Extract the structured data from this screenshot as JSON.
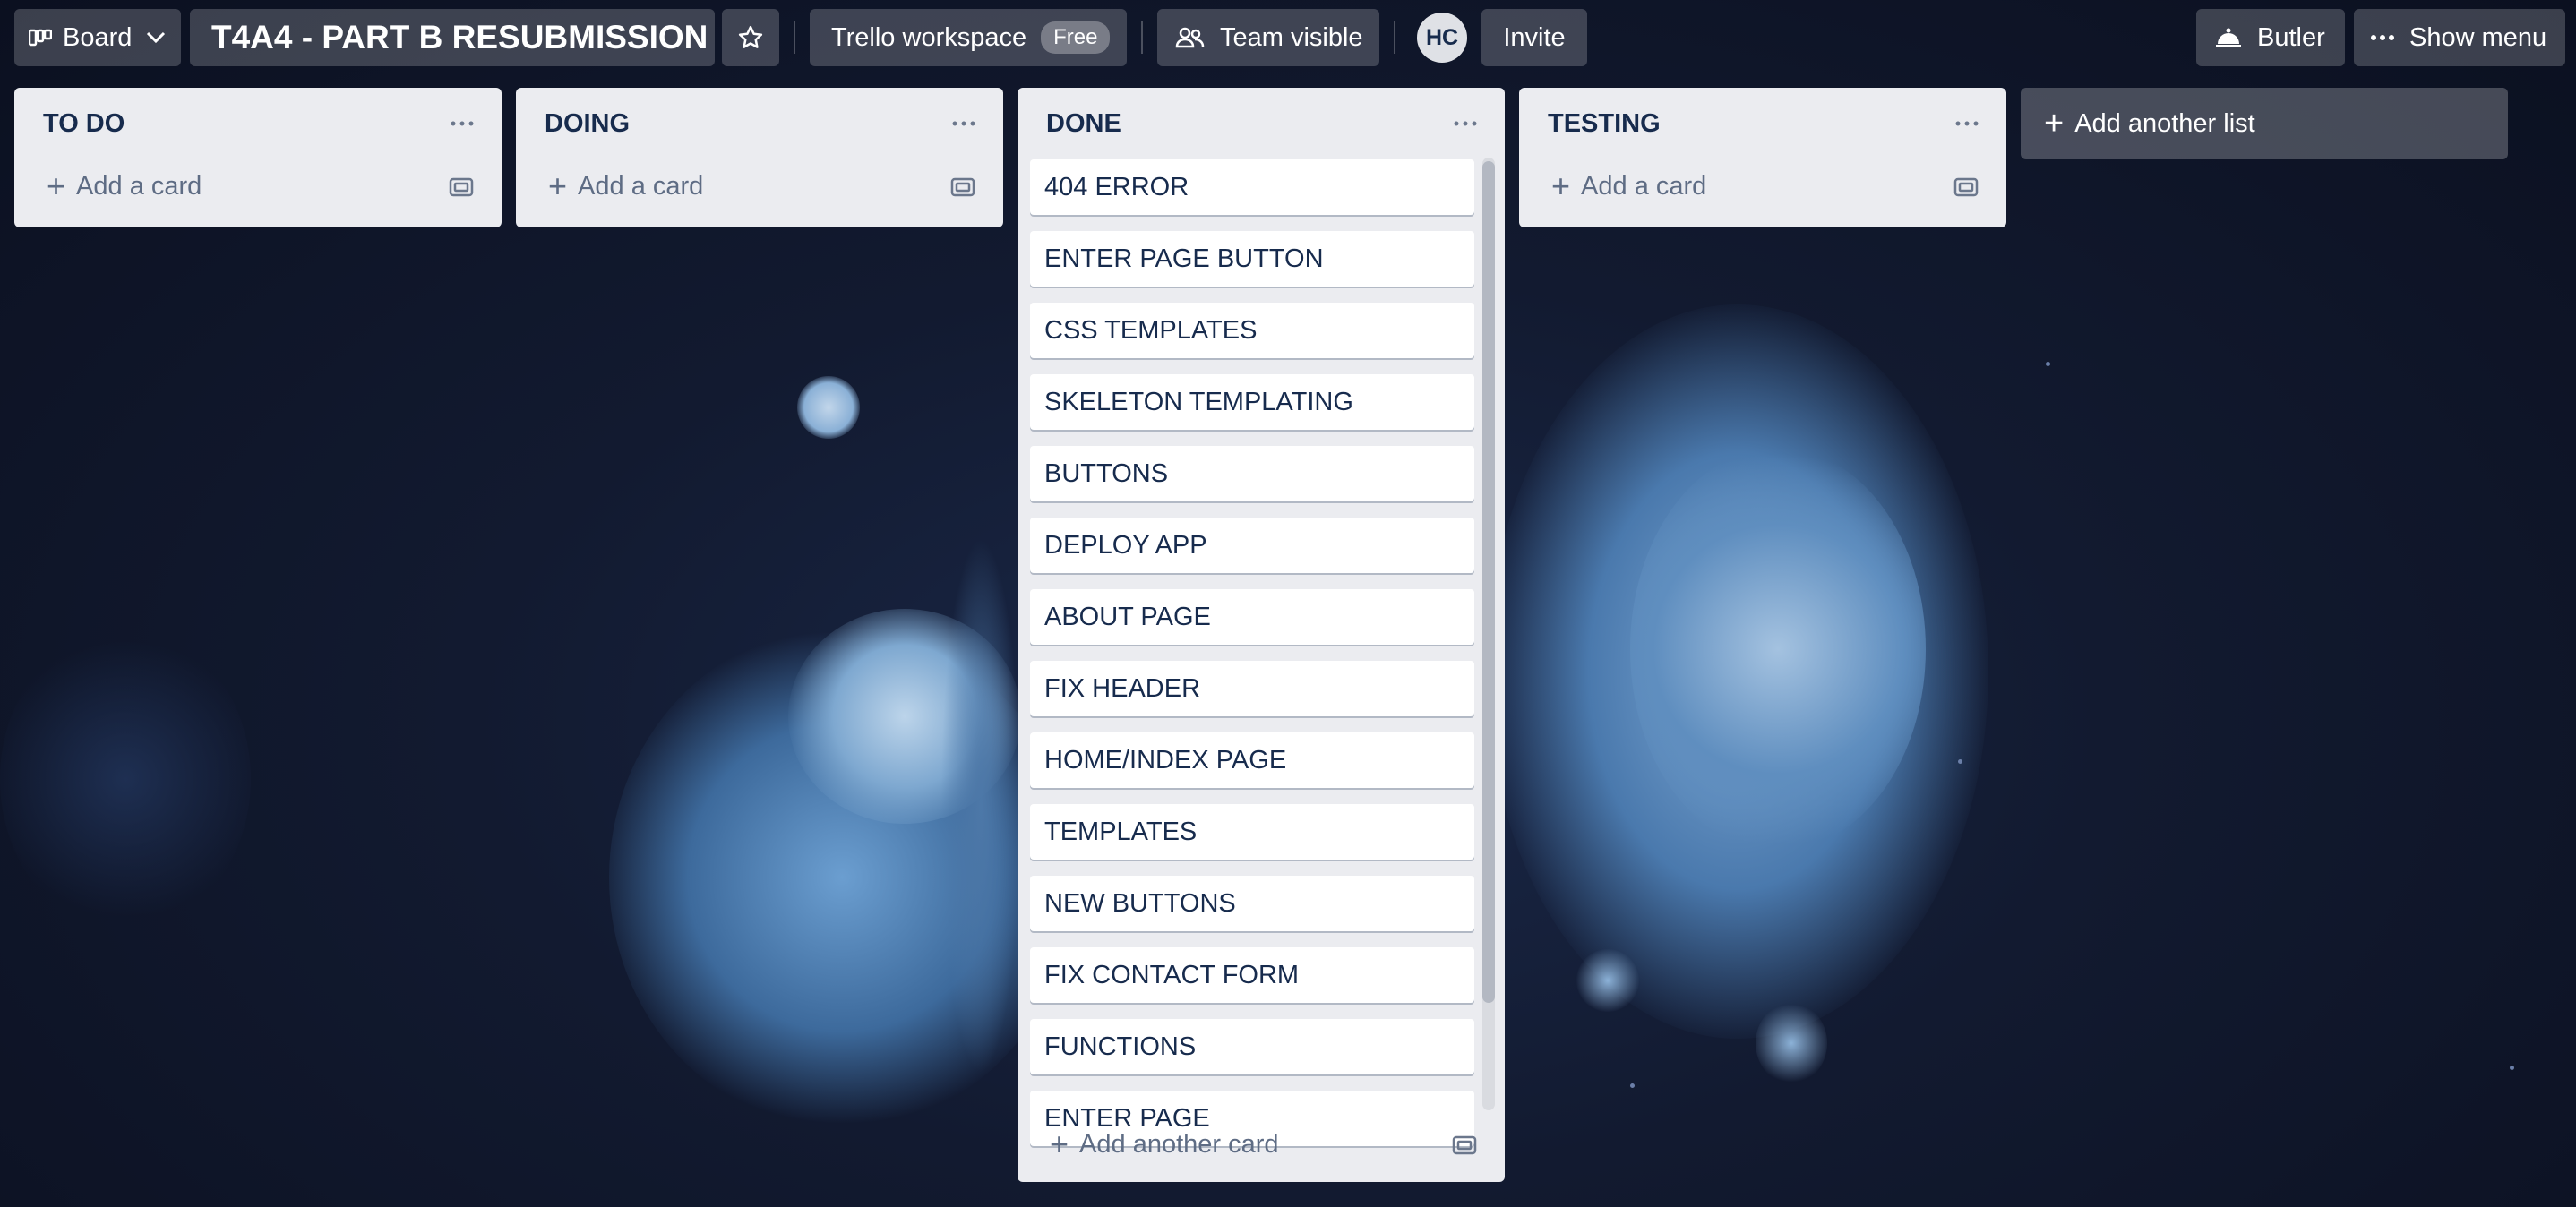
{
  "header": {
    "board_switcher_label": "Board",
    "board_title": "T4A4 - PART B RESUBMISSION",
    "workspace_label": "Trello workspace",
    "workspace_plan": "Free",
    "visibility_label": "Team visible",
    "avatar_initials": "HC",
    "invite_label": "Invite",
    "butler_label": "Butler",
    "show_menu_label": "Show menu"
  },
  "lists": [
    {
      "title": "TO DO",
      "add_card_label": "Add a card",
      "cards": []
    },
    {
      "title": "DOING",
      "add_card_label": "Add a card",
      "cards": []
    },
    {
      "title": "DONE",
      "add_card_label": "Add another card",
      "cards": [
        "404 ERROR",
        "ENTER PAGE BUTTON",
        "CSS TEMPLATES",
        "SKELETON TEMPLATING",
        "BUTTONS",
        "DEPLOY APP",
        "ABOUT PAGE",
        "FIX HEADER",
        "HOME/INDEX PAGE",
        "TEMPLATES",
        "NEW BUTTONS",
        "FIX CONTACT FORM",
        "FUNCTIONS",
        "ENTER PAGE"
      ]
    },
    {
      "title": "TESTING",
      "add_card_label": "Add a card",
      "cards": []
    }
  ],
  "add_list_label": "Add another list",
  "colors": {
    "list_bg": "#ebecf0",
    "card_text": "#172b4d",
    "muted_text": "#5e6c84",
    "background": "#0f1526"
  },
  "icons": {
    "board": "board-icon",
    "chevron": "chevron-down-icon",
    "star": "star-icon",
    "team": "team-icon",
    "butler": "bell-icon",
    "menu": "more-icon",
    "list_menu": "more-icon",
    "template": "card-template-icon",
    "add": "plus-icon"
  }
}
